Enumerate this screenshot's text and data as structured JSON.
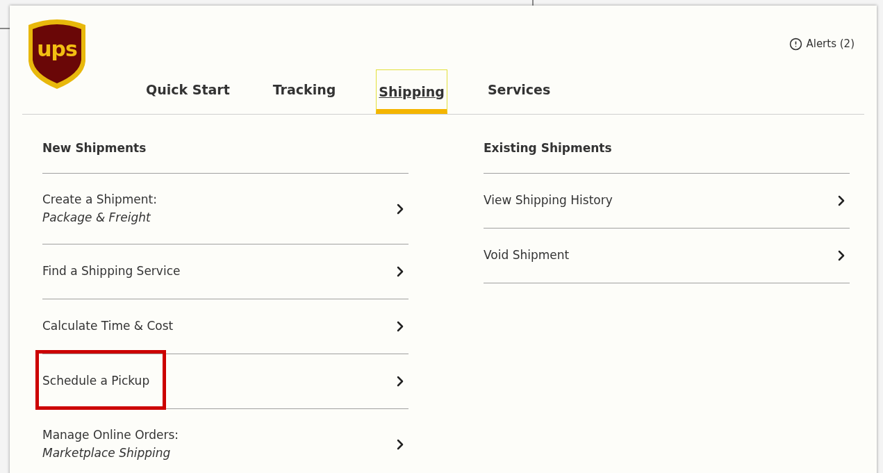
{
  "logo": {
    "text": "ups"
  },
  "alerts": {
    "label": "Alerts (2)"
  },
  "tabs": [
    {
      "label": "Quick Start",
      "selected": false
    },
    {
      "label": "Tracking",
      "selected": false
    },
    {
      "label": "Shipping",
      "selected": true
    },
    {
      "label": "Services",
      "selected": false
    }
  ],
  "columns": [
    {
      "heading": "New Shipments",
      "items": [
        {
          "label": "Create a Shipment:",
          "sublabel": "Package & Freight",
          "highlighted": false
        },
        {
          "label": "Find a Shipping Service",
          "highlighted": false
        },
        {
          "label": "Calculate Time & Cost",
          "highlighted": false
        },
        {
          "label": "Schedule a Pickup",
          "highlighted": true
        },
        {
          "label": "Manage Online Orders:",
          "sublabel": "Marketplace Shipping",
          "highlighted": false
        }
      ]
    },
    {
      "heading": "Existing Shipments",
      "items": [
        {
          "label": "View Shipping History",
          "highlighted": false
        },
        {
          "label": "Void Shipment",
          "highlighted": false
        }
      ]
    }
  ]
}
